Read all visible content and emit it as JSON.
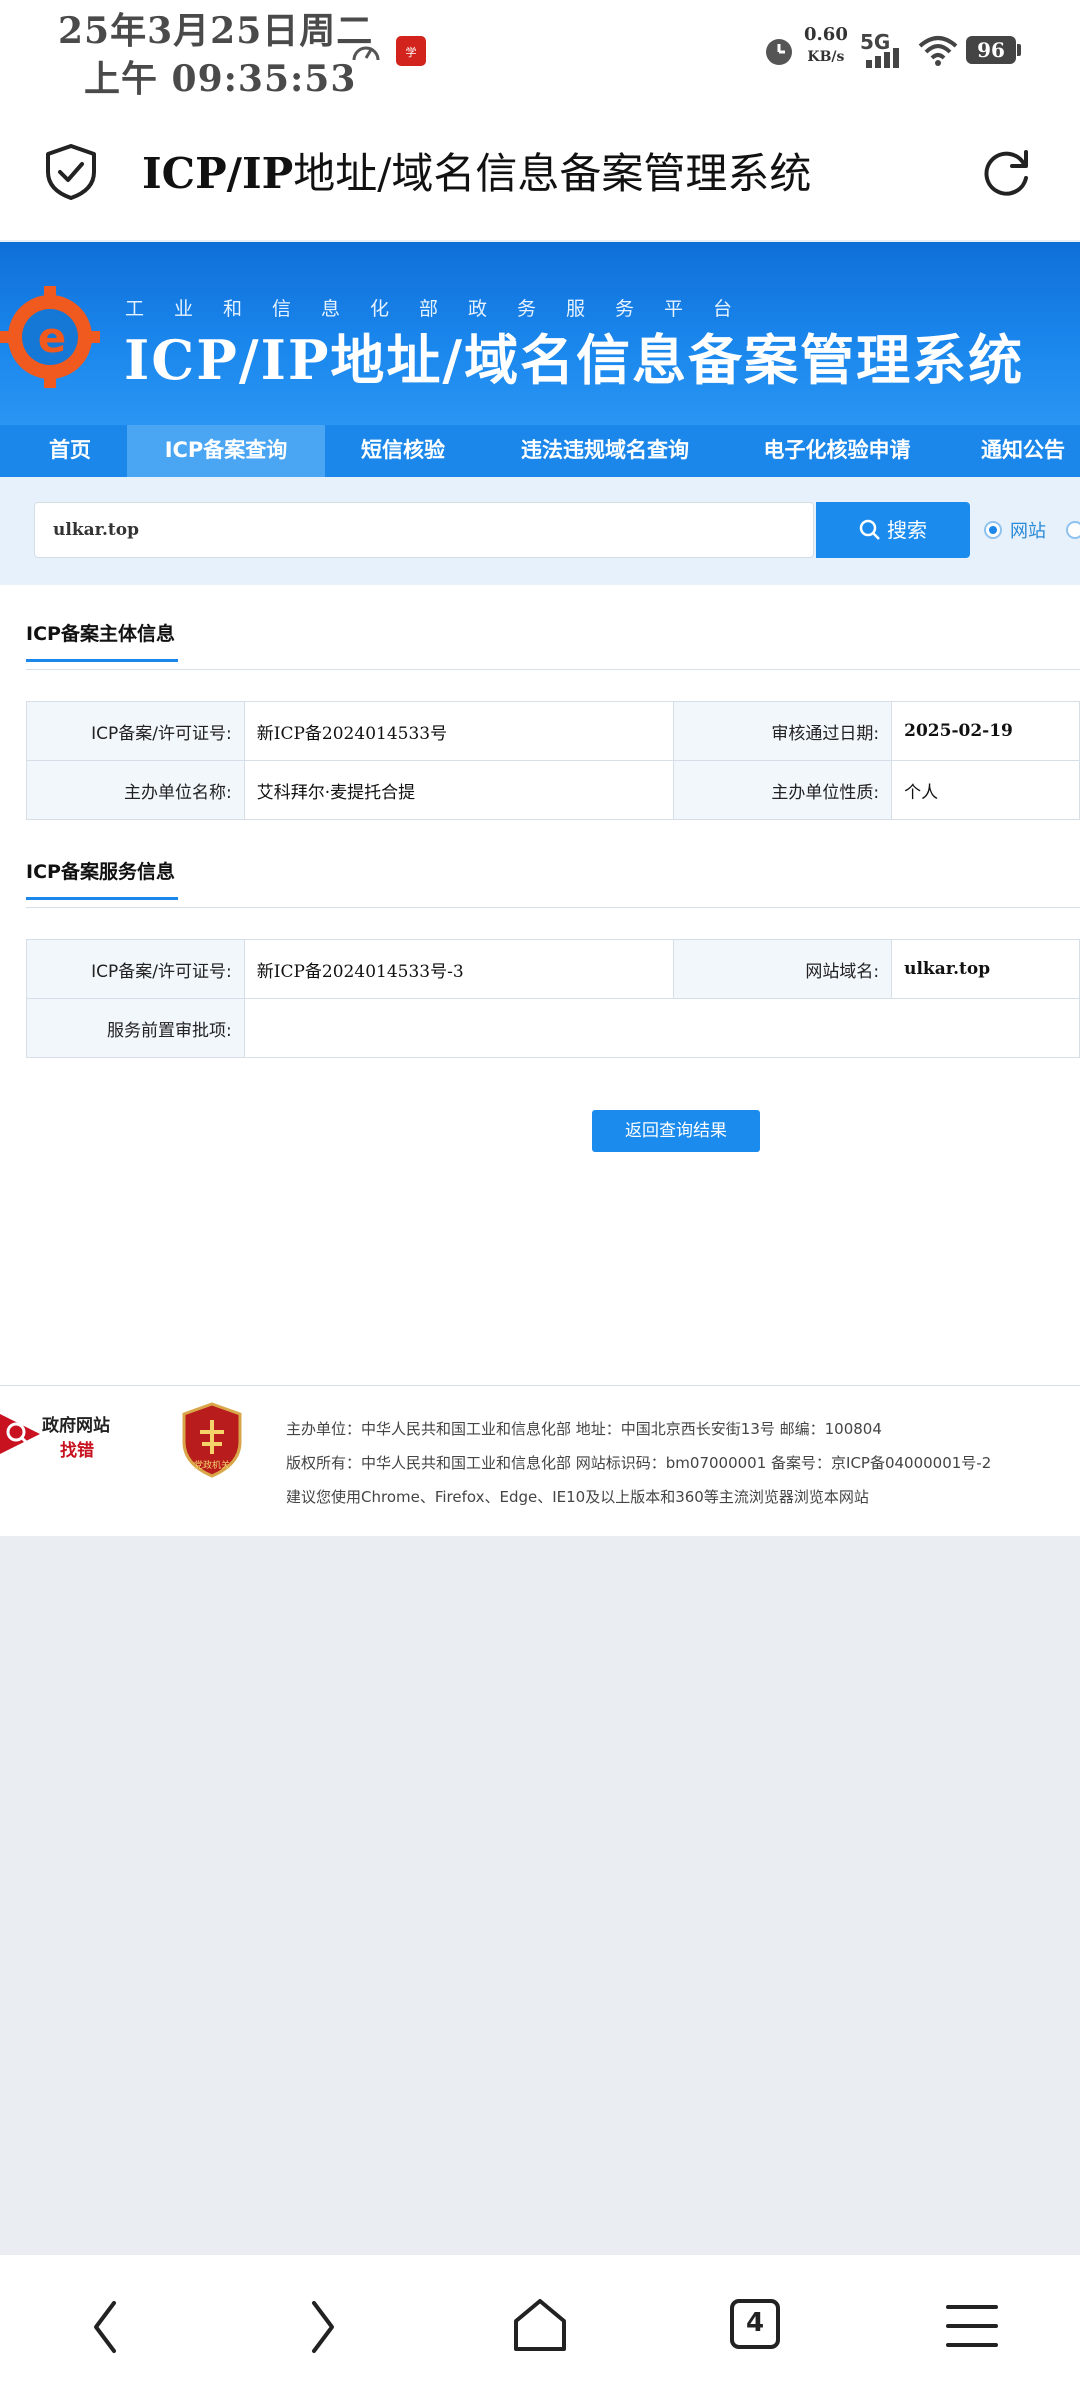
{
  "status_bar": {
    "date": "25年3月25日周二",
    "time": "上午  09:35:53",
    "net_speed": "0.60",
    "net_unit": "KB/s",
    "network": "5G",
    "battery": "96"
  },
  "browser": {
    "title_latin": "ICP/IP",
    "title_rest": "地址/域名信息备案管理系统",
    "icons": [
      "shield-check-icon",
      "refresh-icon"
    ]
  },
  "banner": {
    "subtitle": "工业和信息化部政务服务平台",
    "title": "ICP/IP地址/域名信息备案管理系统"
  },
  "nav": {
    "items": [
      "首页",
      "ICP备案查询",
      "短信核验",
      "违法违规域名查询",
      "电子化核验申请",
      "通知公告"
    ],
    "active": "ICP备案查询"
  },
  "search": {
    "value": "ulkar.top",
    "button": "搜索",
    "radio_label": "网站"
  },
  "subject_section": {
    "title": "ICP备案主体信息",
    "rows": [
      {
        "label1": "ICP备案/许可证号:",
        "value1": "新ICP备2024014533号",
        "label2": "审核通过日期:",
        "value2": "2025-02-19"
      },
      {
        "label1": "主办单位名称:",
        "value1": "艾科拜尔·麦提托合提",
        "label2": "主办单位性质:",
        "value2": "个人"
      }
    ]
  },
  "service_section": {
    "title": "ICP备案服务信息",
    "rows": [
      {
        "label1": "ICP备案/许可证号:",
        "value1": "新ICP备2024014533号-3",
        "label2": "网站域名:",
        "value2": "ulkar.top"
      },
      {
        "label1": "服务前置审批项:",
        "value1": ""
      }
    ]
  },
  "back_button": "返回查询结果",
  "footer": {
    "gov_site_line1": "政府网站",
    "gov_site_line2": "找错",
    "badge_text": "党政机关",
    "line1": "主办单位：中华人民共和国工业和信息化部      地址：中国北京西长安街13号      邮编：100804",
    "line2": "版权所有：中华人民共和国工业和信息化部      网站标识码：bm07000001      备案号：京ICP备04000001号-2",
    "line3": "建议您使用Chrome、Firefox、Edge、IE10及以上版本和360等主流浏览器浏览本网站"
  },
  "system_nav": {
    "tabs_count": "4",
    "icons": [
      "back-icon",
      "forward-icon",
      "home-icon",
      "tabs-icon",
      "menu-icon"
    ]
  },
  "colors": {
    "primary": "#1b87ea",
    "label_bg": "#f2f7fc",
    "page_bg": "#eaeef2"
  }
}
